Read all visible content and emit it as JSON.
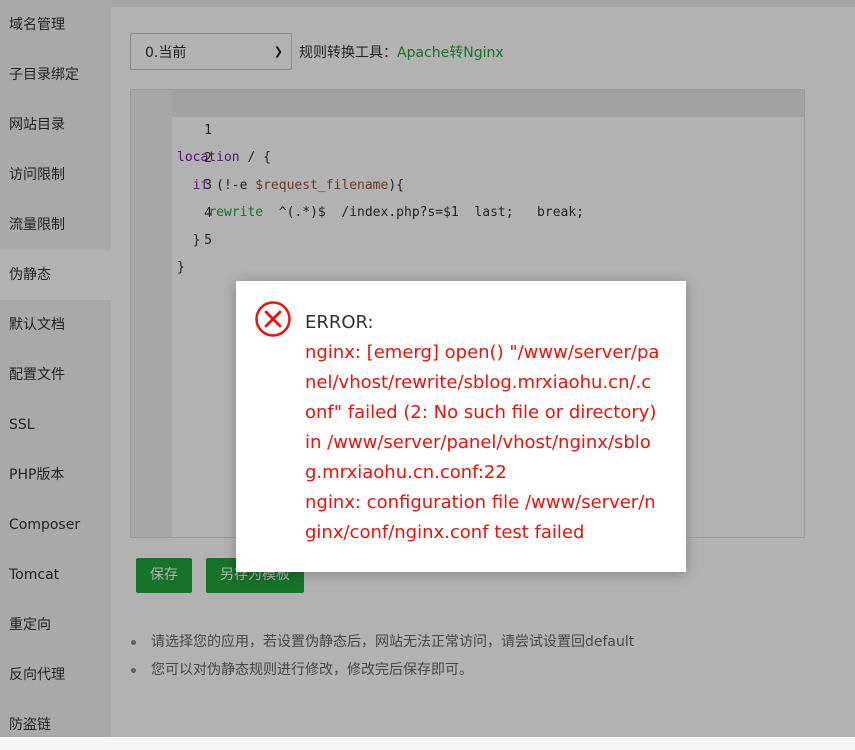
{
  "sidebar": {
    "items": [
      {
        "label": "域名管理",
        "active": false
      },
      {
        "label": "子目录绑定",
        "active": false
      },
      {
        "label": "网站目录",
        "active": false
      },
      {
        "label": "访问限制",
        "active": false
      },
      {
        "label": "流量限制",
        "active": false
      },
      {
        "label": "伪静态",
        "active": true
      },
      {
        "label": "默认文档",
        "active": false
      },
      {
        "label": "配置文件",
        "active": false
      },
      {
        "label": "SSL",
        "active": false
      },
      {
        "label": "PHP版本",
        "active": false
      },
      {
        "label": "Composer",
        "active": false
      },
      {
        "label": "Tomcat",
        "active": false
      },
      {
        "label": "重定向",
        "active": false
      },
      {
        "label": "反向代理",
        "active": false
      },
      {
        "label": "防盗链",
        "active": false
      }
    ]
  },
  "toolbar": {
    "select_value": "0.当前",
    "tool_label": "规则转换工具：",
    "tool_link": "Apache转Nginx"
  },
  "editor": {
    "line_numbers": [
      "1",
      "2",
      "3",
      "4",
      "5"
    ]
  },
  "buttons": {
    "save": "保存",
    "save_as_template": "另存为模板"
  },
  "notes": [
    "请选择您的应用，若设置伪静态后，网站无法正常访问，请尝试设置回default",
    "您可以对伪静态规则进行修改，修改完后保存即可。"
  ],
  "dialog": {
    "icon": "error-circle-icon",
    "title": "ERROR:",
    "line1": "nginx: [emerg] open() \"/www/server/panel/vhost/rewrite/sblog.mrxiaohu.cn/.conf\" failed (2: No such file or directory) in /www/server/panel/vhost/nginx/sblog.mrxiaohu.cn.conf:22",
    "line2": "nginx: configuration file /www/server/nginx/conf/nginx.conf test failed"
  },
  "colors": {
    "accent": "#20a53a",
    "error": "#e6130e"
  }
}
